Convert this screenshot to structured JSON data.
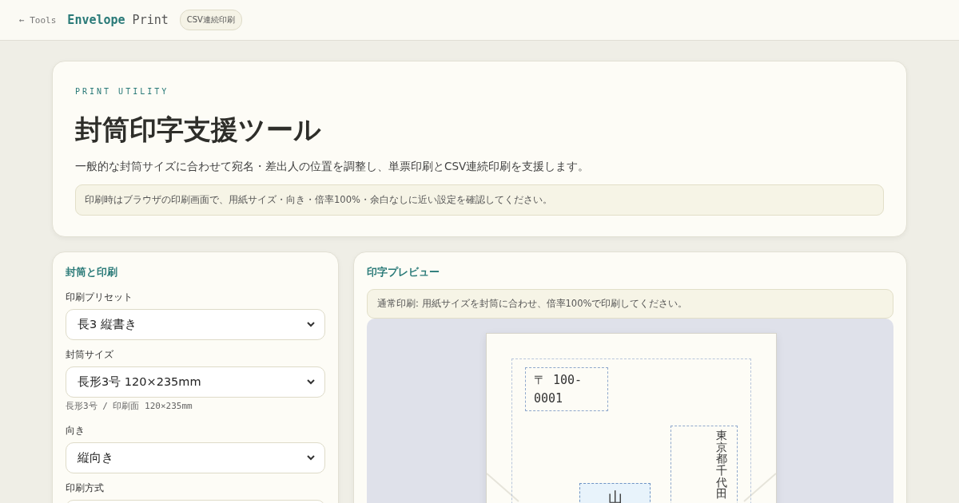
{
  "header": {
    "back_link": "← Tools",
    "title_accent": "Envelope",
    "title_rest": "Print",
    "badge": "CSV連続印刷"
  },
  "hero": {
    "eyebrow": "PRINT UTILITY",
    "title": "封筒印字支援ツール",
    "description": "一般的な封筒サイズに合わせて宛名・差出人の位置を調整し、単票印刷とCSV連続印刷を支援します。",
    "notice": "印刷時はブラウザの印刷画面で、用紙サイズ・向き・倍率100%・余白なしに近い設定を確認してください。"
  },
  "settings": {
    "title": "封筒と印刷",
    "fields": [
      {
        "label": "印刷プリセット",
        "value": "長3 縦書き"
      },
      {
        "label": "封筒サイズ",
        "value": "長形3号 120×235mm",
        "hint": "長形3号 / 印刷面 120×235mm"
      },
      {
        "label": "向き",
        "value": "縦向き"
      },
      {
        "label": "印刷方式"
      }
    ]
  },
  "preview": {
    "title": "印字プレビュー",
    "notice": "通常印刷: 用紙サイズを封筒に合わせ、倍率100%で印刷してください。",
    "postal_code": "〒 100-0001",
    "address": "東京都千代田",
    "name": "山"
  }
}
